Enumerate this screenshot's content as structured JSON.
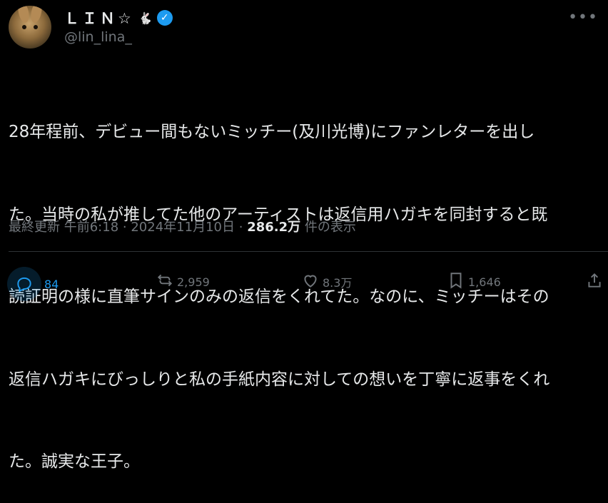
{
  "author": {
    "display_name": "ＬＩＮ☆",
    "name_suffix": "🐇",
    "handle": "@lin_lina_"
  },
  "tweet": {
    "lines": [
      "28年程前、デビュー間もないミッチー(及川光博)にファンレターを出し",
      "た。当時の私が推してた他のアーティストは返信用ハガキを同封すると既",
      "読証明の様に直筆サインのみの返信をくれてた。なのに、ミッチーはその",
      "返信ハガキにびっしりと私の手紙内容に対しての想いを丁寧に返事をくれ",
      "た。誠実な王子。"
    ]
  },
  "meta": {
    "updated_label": "最終更新",
    "time": "午前6:18",
    "separator": "·",
    "date": "2024年11月10日",
    "views": "286.2万",
    "views_label": "件の表示"
  },
  "actions": {
    "reply_count": "84",
    "retweet_count": "2,959",
    "like_count": "8.3万",
    "bookmark_count": "1,646"
  },
  "colors": {
    "background": "#000000",
    "text": "#e7e9ea",
    "muted": "#71767b",
    "accent": "#1d9bf0"
  }
}
